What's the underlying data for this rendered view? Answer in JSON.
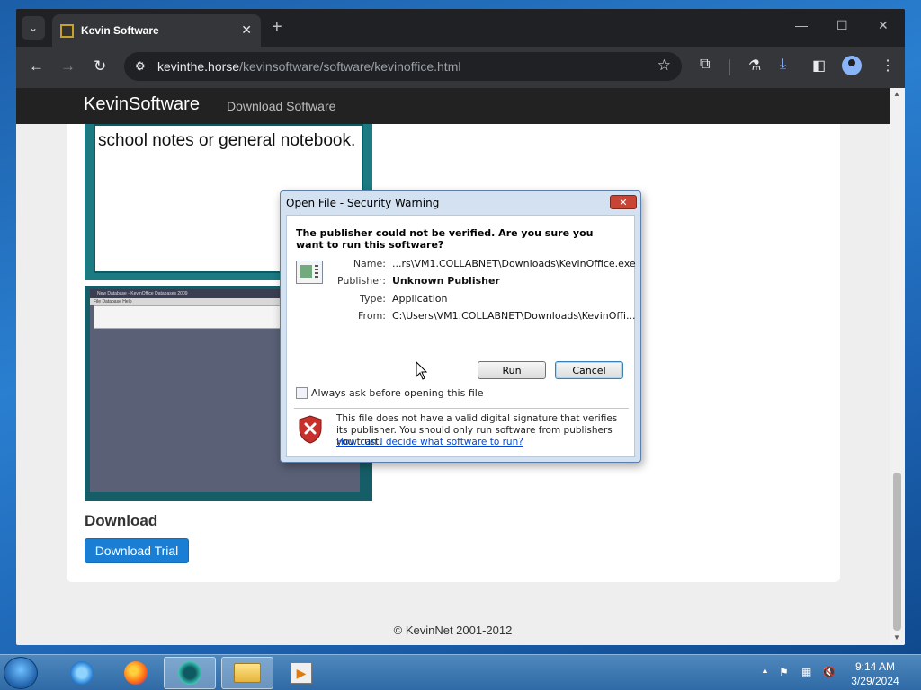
{
  "browser": {
    "tab_title": "Kevin Software",
    "url_host": "kevinthe.horse",
    "url_path": "/kevinsoftware/software/kevinoffice.html",
    "tab_list_icon": "chevron-down-icon",
    "new_tab_icon": "plus-icon"
  },
  "window_controls": {
    "minimize": "—",
    "maximize": "☐",
    "close": "✕"
  },
  "site": {
    "brand": "KevinSoftware",
    "nav_download": "Download Software",
    "screenshot1_text": "school notes or general notebook.",
    "screenshot2_title": "New Database - KevinOffice Databases 2009",
    "screenshot2_menu": "File   Database   Help",
    "download_heading": "Download",
    "download_button": "Download Trial",
    "footer": "© KevinNet 2001-2012"
  },
  "dialog": {
    "title": "Open File - Security Warning",
    "question": "The publisher could not be verified.  Are you sure you want to run this software?",
    "name_label": "Name:",
    "name_value": "...rs\\VM1.COLLABNET\\Downloads\\KevinOffice.exe",
    "publisher_label": "Publisher:",
    "publisher_value": "Unknown Publisher",
    "type_label": "Type:",
    "type_value": "Application",
    "from_label": "From:",
    "from_value": "C:\\Users\\VM1.COLLABNET\\Downloads\\KevinOffi...",
    "run_button": "Run",
    "cancel_button": "Cancel",
    "checkbox_label": "Always ask before opening this file",
    "warning_text": "This file does not have a valid digital signature that verifies its publisher.  You should only run software from publishers you trust.",
    "warning_link": "How can I decide what software to run?"
  },
  "taskbar": {
    "apps": [
      "internet-explorer-icon",
      "firefox-icon",
      "chrome-icon",
      "file-explorer-icon",
      "media-player-icon"
    ],
    "clock_time": "9:14 AM",
    "clock_date": "3/29/2024"
  },
  "colors": {
    "dialog_frame": "#d3e1f1",
    "link": "#0046d5",
    "download_button": "#1a7fd4",
    "site_nav": "#222222"
  }
}
